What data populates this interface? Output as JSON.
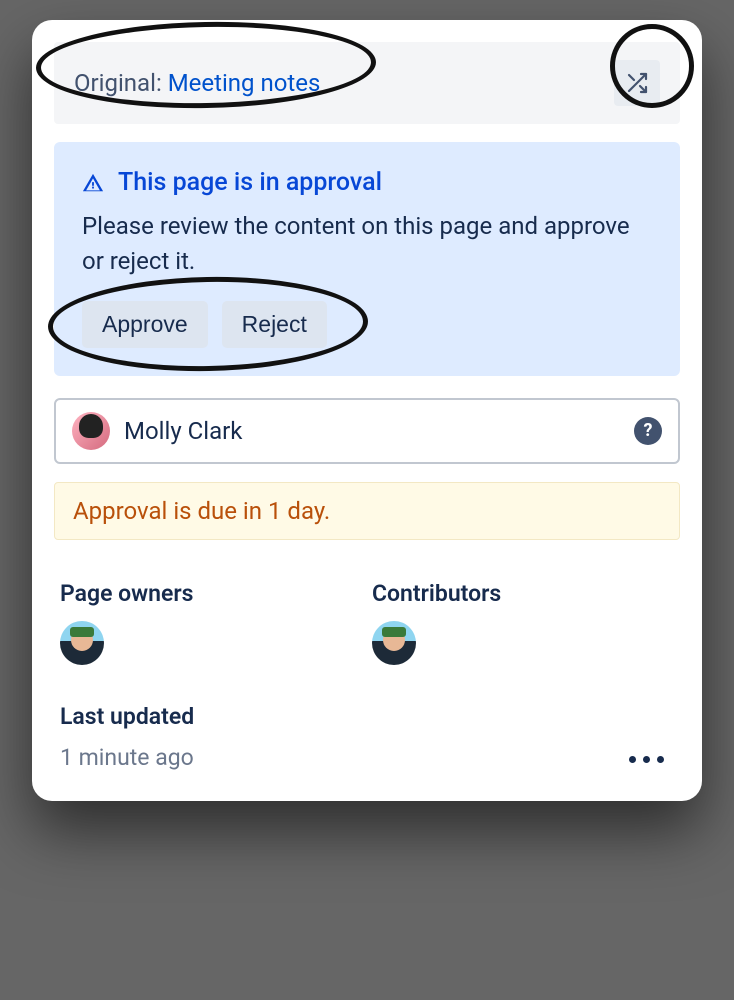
{
  "header": {
    "original_prefix": "Original: ",
    "original_link_text": "Meeting notes"
  },
  "approval": {
    "title": "This page is in approval",
    "description": "Please review the content on this page and approve or reject it.",
    "approve_label": "Approve",
    "reject_label": "Reject"
  },
  "assignee": {
    "name": "Molly Clark"
  },
  "due": {
    "text": "Approval is due in 1 day."
  },
  "page_owners": {
    "label": "Page owners"
  },
  "contributors": {
    "label": "Contributors"
  },
  "last_updated": {
    "label": "Last updated",
    "value": "1 minute ago"
  }
}
